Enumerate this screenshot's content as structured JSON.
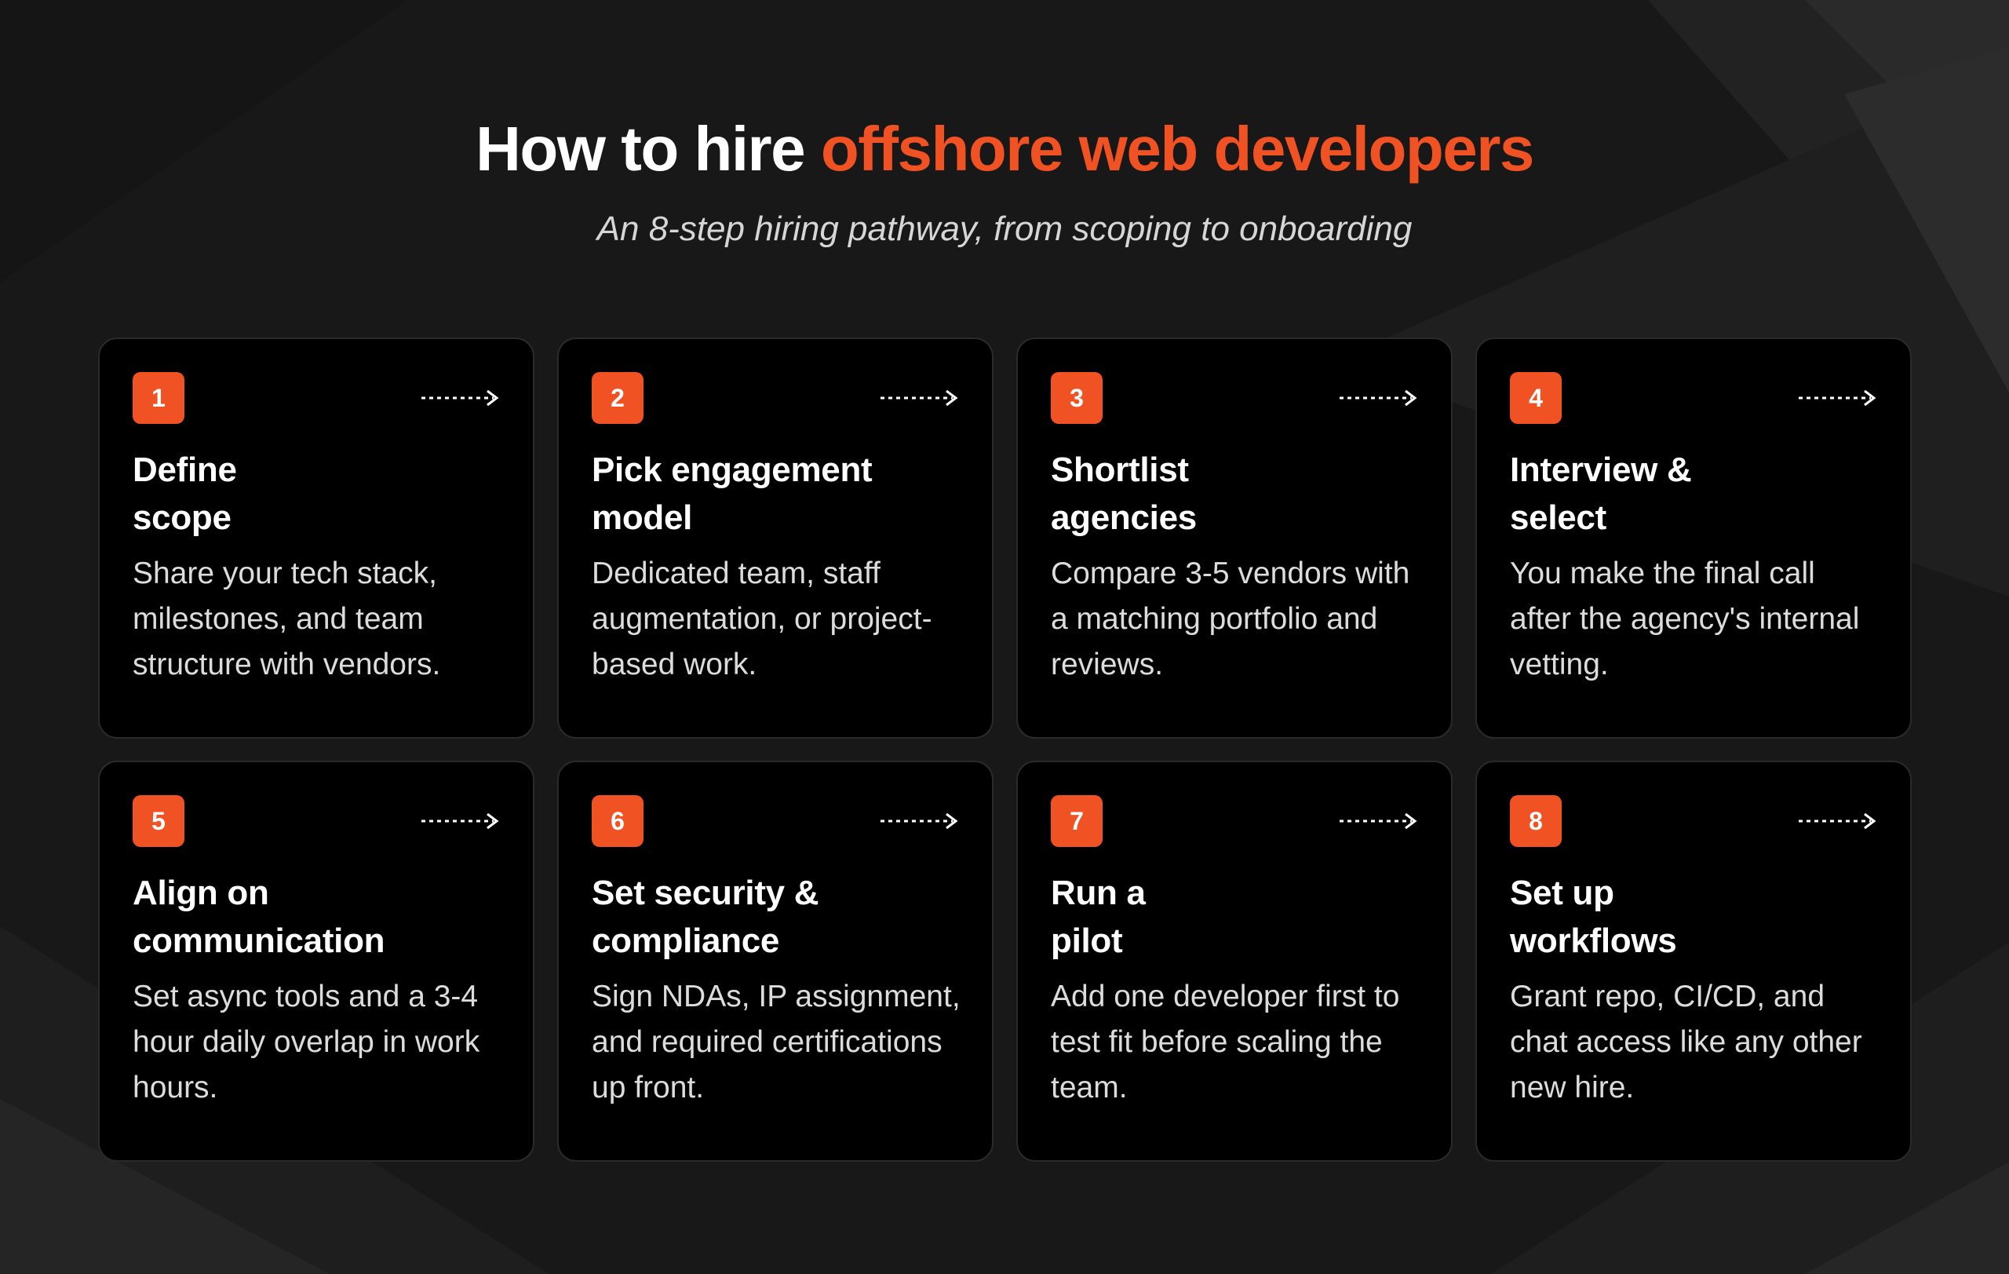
{
  "header": {
    "title_prefix": "How to hire ",
    "title_accent": "offshore web developers",
    "subtitle": "An 8-step hiring pathway, from scoping to onboarding"
  },
  "colors": {
    "accent": "#f05223",
    "background": "#1a1a1a",
    "card": "#000000"
  },
  "steps": [
    {
      "number": "1",
      "title": "Define\nscope",
      "description": "Share your tech stack, milestones, and team structure with vendors.",
      "icon": "dashed-arrow-right-icon"
    },
    {
      "number": "2",
      "title": "Pick engagement\nmodel",
      "description": "Dedicated team, staff augmentation, or project-based work.",
      "icon": "dashed-arrow-right-icon"
    },
    {
      "number": "3",
      "title": "Shortlist\nagencies",
      "description": "Compare 3-5 vendors with a matching portfolio and reviews.",
      "icon": "dashed-arrow-right-icon"
    },
    {
      "number": "4",
      "title": "Interview &\nselect",
      "description": "You make the final call after the agency's internal vetting.",
      "icon": "dashed-arrow-right-icon"
    },
    {
      "number": "5",
      "title": "Align on\ncommunication",
      "description": "Set async tools and a 3-4 hour daily overlap in work hours.",
      "icon": "dashed-arrow-right-icon"
    },
    {
      "number": "6",
      "title": "Set security &\ncompliance",
      "description": "Sign NDAs, IP assignment, and required certifications up front.",
      "icon": "dashed-arrow-right-icon"
    },
    {
      "number": "7",
      "title": "Run a\npilot",
      "description": "Add one developer first to test fit before scaling the team.",
      "icon": "dashed-arrow-right-icon"
    },
    {
      "number": "8",
      "title": "Set up\nworkflows",
      "description": "Grant repo, CI/CD, and chat access like any other new hire.",
      "icon": "dashed-arrow-right-icon"
    }
  ]
}
